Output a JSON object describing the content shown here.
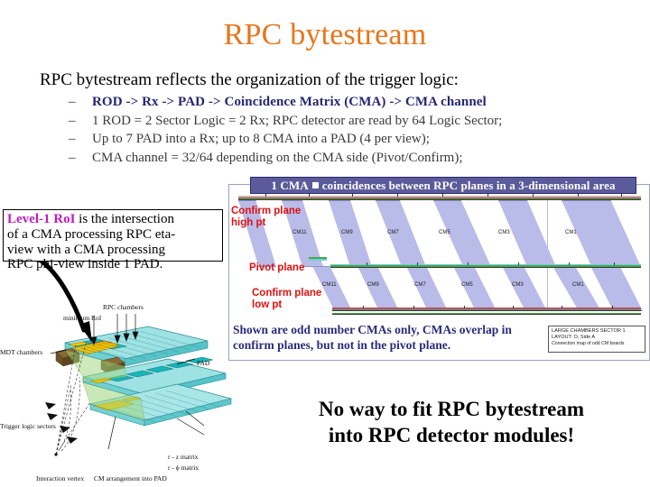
{
  "slide": {
    "title": "RPC bytestream",
    "lead": "RPC bytestream reflects the organization of the trigger logic:",
    "bullets": [
      "ROD -> Rx -> PAD -> Coincidence Matrix (CMA) -> CMA channel",
      "1 ROD = 2 Sector Logic = 2 Rx; RPC detector are read by 64 Logic Sector;",
      "Up to 7 PAD into a Rx; up to 8 CMA into a PAD (4 per view);",
      "CMA channel = 32/64 depending on the CMA side (Pivot/Confirm);"
    ],
    "dash": "–",
    "statement_line1": "No way to fit RPC bytestream",
    "statement_line2": "into RPC detector modules!"
  },
  "callout": {
    "highlight": "Level-1 RoI",
    "line1_rest": " is the intersection",
    "line2": "of a CMA processing RPC eta-",
    "line3": "view with a CMA processing",
    "line4": "RPC phi-view inside 1 PAD."
  },
  "diagram": {
    "banner_before": "1 CMA",
    "banner_after": "coincidences between RPC planes in a 3-dimensional area",
    "plane_labels": [
      "Confirm plane",
      "high pt",
      "Pivot plane",
      "Confirm plane",
      "low pt"
    ],
    "cma_top": [
      "CM11",
      "CM9",
      "CM7",
      "CM5",
      "CM3",
      "CM1"
    ],
    "cma_bottom": [
      "CM11",
      "CM9",
      "CM7",
      "CM5",
      "CM3",
      "CM1"
    ],
    "note_line1": "Shown are odd number CMAs only, CMAs overlap in",
    "note_line2": "confirm planes, but not in the pivot plane.",
    "legend_line1": "LARGE CHAMBERS SECTOR 1",
    "legend_line2": "LAYOUT: O, Side A",
    "legend_line3": "Connection map of odd CM boards"
  },
  "detector": {
    "labels": {
      "rpc_chambers": "RPC chambers",
      "minimum_roi": "minimum RoI",
      "mdt_chambers": "MDT chambers",
      "pad": "PAD",
      "trigger_logic_sectors": "Trigger logic sectors",
      "rz_matrix": "r - z matrix",
      "rphi_matrix": "r - ϕ matrix",
      "interaction_vertex": "Interaction vertex",
      "cm_arrangement": "CM arrangement into PAD"
    }
  },
  "colors": {
    "title": "#E8761A",
    "bullet_first": "#262673",
    "bullet_rest": "#3A3A3A",
    "banner_bg": "#5B5B9B",
    "red_caption": "#E01010",
    "blue_note": "#2B2B7A",
    "highlight": "#C01BC0",
    "cma_fill": "#B9BBE8"
  }
}
